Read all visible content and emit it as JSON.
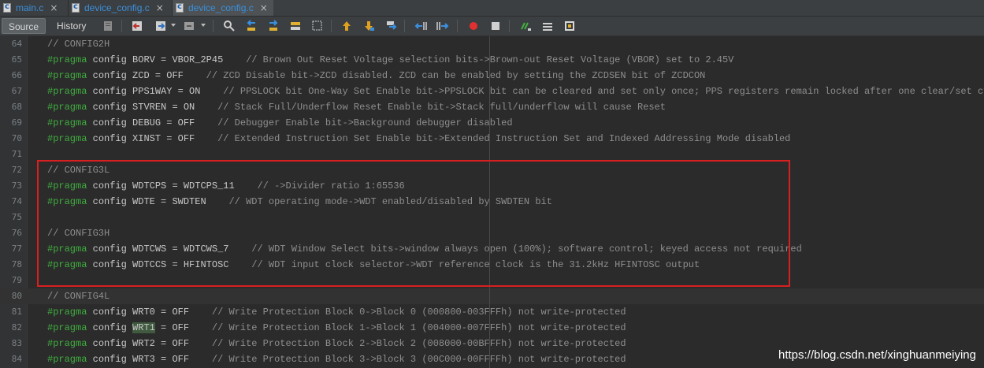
{
  "tabs": [
    {
      "label": "main.c",
      "close": "×"
    },
    {
      "label": "device_config.c",
      "close": "×"
    },
    {
      "label": "device_config.c",
      "close": "×"
    }
  ],
  "toolbar": {
    "source_label": "Source",
    "history_label": "History"
  },
  "colors": {
    "redbox": "#d82020",
    "pragma": "#3fae3f",
    "comment": "#8e8e8e",
    "tab_text": "#3a8fdc"
  },
  "lines": [
    {
      "num": "64",
      "type": "comment",
      "text": "// CONFIG2H"
    },
    {
      "num": "65",
      "type": "pragma",
      "pp": "#pragma",
      "kw": "config",
      "setting": " BORV = VBOR_2P45    ",
      "comment": "// Brown Out Reset Voltage selection bits->Brown-out Reset Voltage (VBOR) set to 2.45V"
    },
    {
      "num": "66",
      "type": "pragma",
      "pp": "#pragma",
      "kw": "config",
      "setting": " ZCD = OFF    ",
      "comment": "// ZCD Disable bit->ZCD disabled. ZCD can be enabled by setting the ZCDSEN bit of ZCDCON"
    },
    {
      "num": "67",
      "type": "pragma",
      "pp": "#pragma",
      "kw": "config",
      "setting": " PPS1WAY = ON    ",
      "comment": "// PPSLOCK bit One-Way Set Enable bit->PPSLOCK bit can be cleared and set only once; PPS registers remain locked after one clear/set cycle"
    },
    {
      "num": "68",
      "type": "pragma",
      "pp": "#pragma",
      "kw": "config",
      "setting": " STVREN = ON    ",
      "comment": "// Stack Full/Underflow Reset Enable bit->Stack full/underflow will cause Reset"
    },
    {
      "num": "69",
      "type": "pragma",
      "pp": "#pragma",
      "kw": "config",
      "setting": " DEBUG = OFF    ",
      "comment": "// Debugger Enable bit->Background debugger disabled"
    },
    {
      "num": "70",
      "type": "pragma",
      "pp": "#pragma",
      "kw": "config",
      "setting": " XINST = OFF    ",
      "comment": "// Extended Instruction Set Enable bit->Extended Instruction Set and Indexed Addressing Mode disabled"
    },
    {
      "num": "71",
      "type": "blank",
      "text": ""
    },
    {
      "num": "72",
      "type": "comment",
      "text": "// CONFIG3L"
    },
    {
      "num": "73",
      "type": "pragma",
      "pp": "#pragma",
      "kw": "config",
      "setting": " WDTCPS = WDTCPS_11    ",
      "comment": "// ->Divider ratio 1:65536"
    },
    {
      "num": "74",
      "type": "pragma",
      "pp": "#pragma",
      "kw": "config",
      "setting": " WDTE = SWDTEN    ",
      "comment": "// WDT operating mode->WDT enabled/disabled by SWDTEN bit"
    },
    {
      "num": "75",
      "type": "blank",
      "text": ""
    },
    {
      "num": "76",
      "type": "comment",
      "text": "// CONFIG3H"
    },
    {
      "num": "77",
      "type": "pragma",
      "pp": "#pragma",
      "kw": "config",
      "setting": " WDTCWS = WDTCWS_7    ",
      "comment": "// WDT Window Select bits->window always open (100%); software control; keyed access not required"
    },
    {
      "num": "78",
      "type": "pragma",
      "pp": "#pragma",
      "kw": "config",
      "setting": " WDTCCS = HFINTOSC    ",
      "comment": "// WDT input clock selector->WDT reference clock is the 31.2kHz HFINTOSC output"
    },
    {
      "num": "79",
      "type": "blank",
      "text": ""
    },
    {
      "num": "80",
      "type": "comment",
      "text": "// CONFIG4L"
    },
    {
      "num": "81",
      "type": "pragma",
      "pp": "#pragma",
      "kw": "config",
      "setting": " WRT0 = OFF    ",
      "comment": "// Write Protection Block 0->Block 0 (000800-003FFFh) not write-protected"
    },
    {
      "num": "82",
      "type": "pragma_mark",
      "pp": "#pragma",
      "kw": "config",
      "pre": " ",
      "mark": "WRT1",
      "setting": " = OFF    ",
      "comment": "// Write Protection Block 1->Block 1 (004000-007FFFh) not write-protected"
    },
    {
      "num": "83",
      "type": "pragma",
      "pp": "#pragma",
      "kw": "config",
      "setting": " WRT2 = OFF    ",
      "comment": "// Write Protection Block 2->Block 2 (008000-00BFFFh) not write-protected"
    },
    {
      "num": "84",
      "type": "pragma",
      "pp": "#pragma",
      "kw": "config",
      "setting": " WRT3 = OFF    ",
      "comment": "// Write Protection Block 3->Block 3 (00C000-00FFFFh) not write-protected"
    }
  ],
  "watermark": "https://blog.csdn.net/xinghuanmeiying"
}
